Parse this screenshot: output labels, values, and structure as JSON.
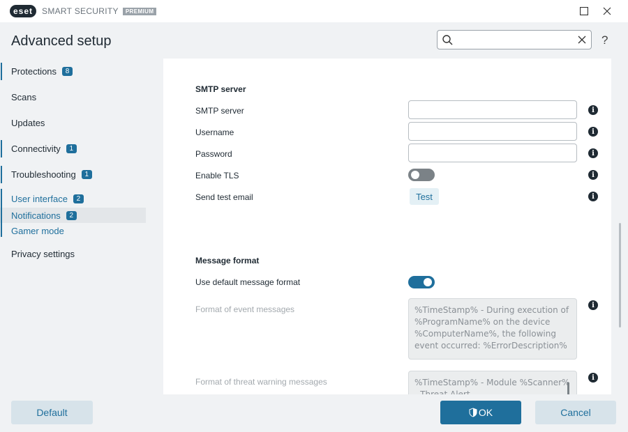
{
  "app": {
    "logo_text": "eset",
    "product_name": "SMART SECURITY",
    "edition": "PREMIUM"
  },
  "window_controls": {
    "maximize_icon": "maximize-icon",
    "close_icon": "close-icon"
  },
  "header": {
    "title": "Advanced setup",
    "search_placeholder": "",
    "search_value": "",
    "help_label": "?"
  },
  "sidebar": {
    "items": [
      {
        "label": "Protections",
        "badge": "8"
      },
      {
        "label": "Scans",
        "badge": null
      },
      {
        "label": "Updates",
        "badge": null
      },
      {
        "label": "Connectivity",
        "badge": "1"
      },
      {
        "label": "Troubleshooting",
        "badge": "1"
      }
    ],
    "sub_items": [
      {
        "label": "User interface",
        "badge": "2"
      },
      {
        "label": "Notifications",
        "badge": "2"
      },
      {
        "label": "Gamer mode",
        "badge": null
      }
    ],
    "last_item": {
      "label": "Privacy settings"
    }
  },
  "smtp": {
    "section_title": "SMTP server",
    "server_label": "SMTP server",
    "server_value": "",
    "username_label": "Username",
    "username_value": "",
    "password_label": "Password",
    "password_value": "",
    "tls_label": "Enable TLS",
    "tls_enabled": false,
    "test_label": "Send test email",
    "test_button": "Test"
  },
  "message_format": {
    "section_title": "Message format",
    "default_label": "Use default message format",
    "default_enabled": true,
    "event_label": "Format of event messages",
    "event_value": "%TimeStamp% - During execution of %ProgramName% on the device %ComputerName%, the following event occurred: %ErrorDescription%",
    "threat_label": "Format of threat warning messages",
    "threat_value": "%TimeStamp% - Module %Scanner% - Threat Alert"
  },
  "info_icon_glyph": "i",
  "footer": {
    "default_button": "Default",
    "ok_button": "OK",
    "cancel_button": "Cancel"
  },
  "colors": {
    "accent": "#1f6f9c",
    "background": "#f0f2f4",
    "panel": "#ffffff"
  }
}
